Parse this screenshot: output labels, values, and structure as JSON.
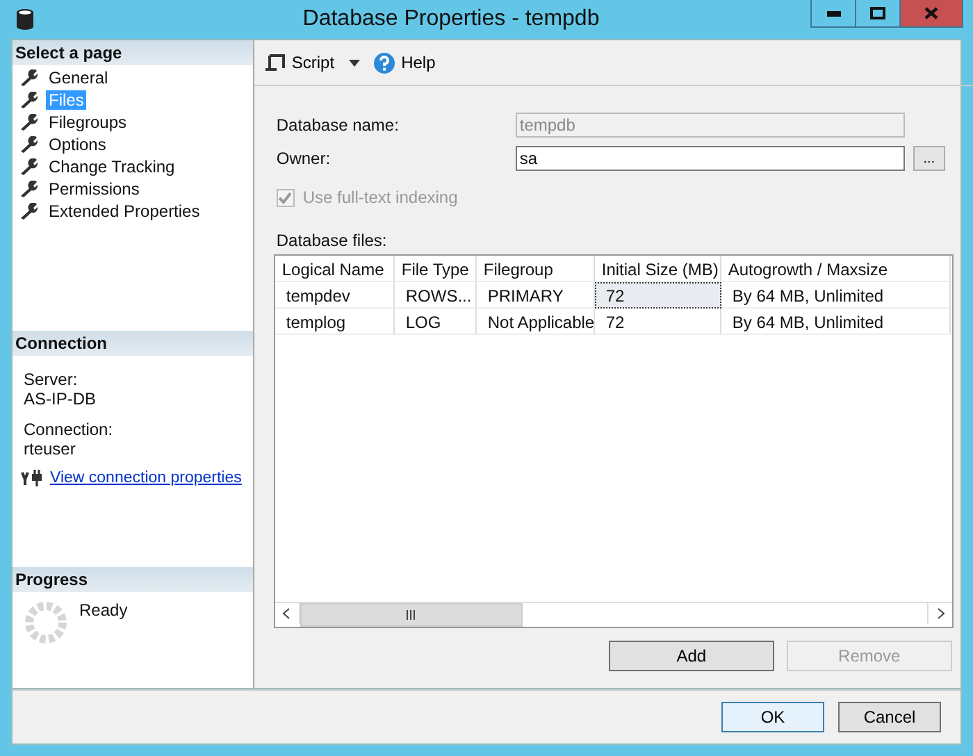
{
  "window": {
    "title": "Database Properties - tempdb"
  },
  "sidebar": {
    "header": "Select a page",
    "items": [
      {
        "label": "General",
        "selected": false
      },
      {
        "label": "Files",
        "selected": true
      },
      {
        "label": "Filegroups",
        "selected": false
      },
      {
        "label": "Options",
        "selected": false
      },
      {
        "label": "Change Tracking",
        "selected": false
      },
      {
        "label": "Permissions",
        "selected": false
      },
      {
        "label": "Extended Properties",
        "selected": false
      }
    ]
  },
  "connection": {
    "header": "Connection",
    "server_label": "Server:",
    "server": "AS-IP-DB",
    "connection_label": "Connection:",
    "user": "rteuser",
    "link": "View connection properties"
  },
  "progress": {
    "header": "Progress",
    "status": "Ready"
  },
  "toolbar": {
    "script": "Script",
    "help": "Help"
  },
  "form": {
    "name_label": "Database name:",
    "name_value": "tempdb",
    "name_disabled": true,
    "owner_label": "Owner:",
    "owner_value": "sa",
    "browse": "...",
    "fulltext_label": "Use full-text indexing",
    "fulltext_checked": true,
    "fulltext_disabled": true
  },
  "table": {
    "label": "Database files:",
    "columns": [
      "Logical Name",
      "File Type",
      "Filegroup",
      "Initial Size (MB)",
      "Autogrowth / Maxsize"
    ],
    "rows": [
      {
        "cells": [
          "tempdev",
          "ROWS...",
          "PRIMARY",
          "72",
          "By 64 MB, Unlimited"
        ],
        "selected": true
      },
      {
        "cells": [
          "templog",
          "LOG",
          "Not Applicable",
          "72",
          "By 64 MB, Unlimited"
        ],
        "selected": false
      }
    ]
  },
  "file_buttons": [
    {
      "label": "Add",
      "disabled": false
    },
    {
      "label": "Remove",
      "disabled": true
    }
  ],
  "dialog_buttons": [
    {
      "label": "OK",
      "kind": "default"
    },
    {
      "label": "Cancel",
      "kind": "normal"
    }
  ]
}
